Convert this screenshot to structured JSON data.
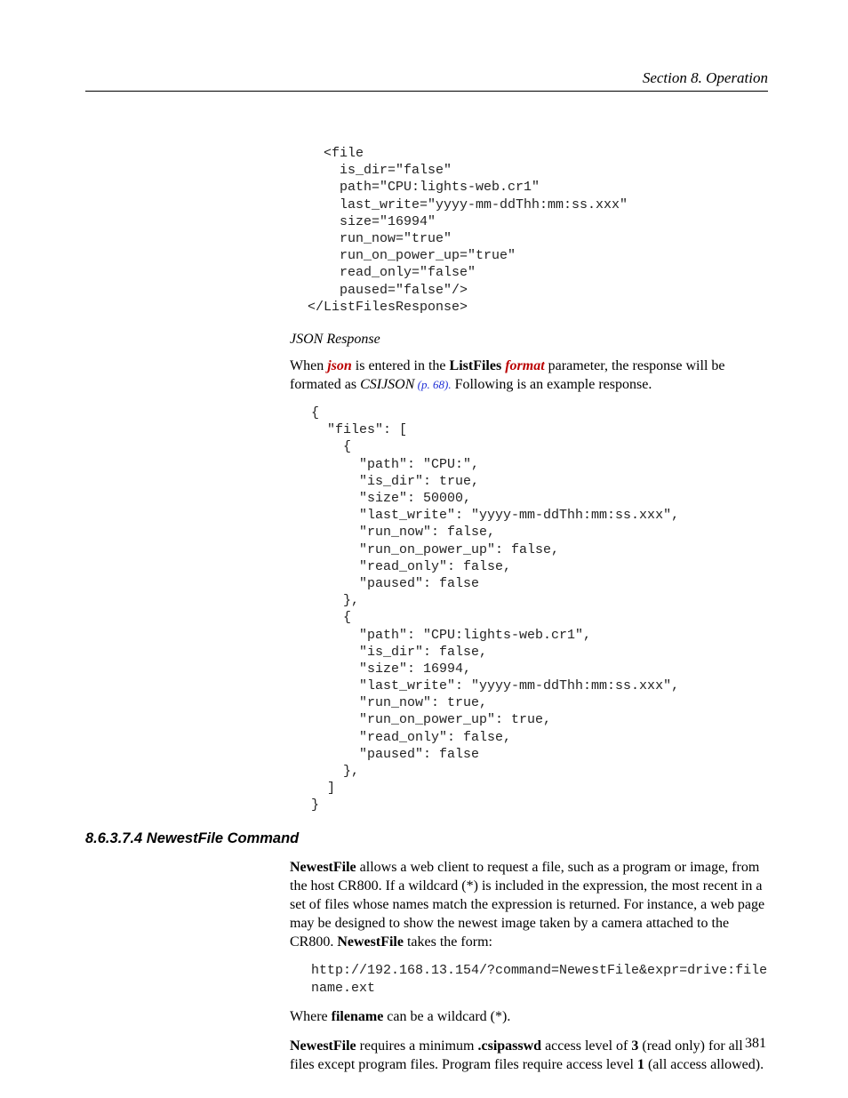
{
  "header": {
    "running_head": "Section 8.  Operation"
  },
  "code1": "  <file\n    is_dir=\"false\"\n    path=\"CPU:lights-web.cr1\"\n    last_write=\"yyyy-mm-ddThh:mm:ss.xxx\"\n    size=\"16994\"\n    run_now=\"true\"\n    run_on_power_up=\"true\"\n    read_only=\"false\"\n    paused=\"false\"/>\n</ListFilesResponse>",
  "json_response_heading": "JSON Response",
  "para1": {
    "t1": "When ",
    "t2": "json",
    "t3": " is entered in the ",
    "t4": "ListFiles",
    "t5": " ",
    "t6": "format",
    "t7": " parameter, the response will be formated as ",
    "t8": "CSIJSON",
    "t9": " (p. 68).",
    "t10": "  Following is an example response."
  },
  "code2": "{\n  \"files\": [\n    {\n      \"path\": \"CPU:\",\n      \"is_dir\": true,\n      \"size\": 50000,\n      \"last_write\": \"yyyy-mm-ddThh:mm:ss.xxx\",\n      \"run_now\": false,\n      \"run_on_power_up\": false,\n      \"read_only\": false,\n      \"paused\": false\n    },\n    {\n      \"path\": \"CPU:lights-web.cr1\",\n      \"is_dir\": false,\n      \"size\": 16994,\n      \"last_write\": \"yyyy-mm-ddThh:mm:ss.xxx\",\n      \"run_now\": true,\n      \"run_on_power_up\": true,\n      \"read_only\": false,\n      \"paused\": false\n    },\n  ]\n}",
  "section_heading": "8.6.3.7.4 NewestFile Command",
  "para2": {
    "t1": "NewestFile",
    "t2": " allows a web client to request a file, such as a program or image, from the host CR800.  If a wildcard (*) is included in the expression, the most recent in a set of files whose names match the expression is returned.  For instance, a web page may be designed to show the newest image taken by a camera attached to the CR800.  ",
    "t3": "NewestFile",
    "t4": " takes the form:"
  },
  "code3": "http://192.168.13.154/?command=NewestFile&expr=drive:filename.ext",
  "para3": {
    "t1": "Where ",
    "t2": "filename",
    "t3": " can be a wildcard (*)."
  },
  "para4": {
    "t1": "NewestFile",
    "t2": " requires a minimum ",
    "t3": ".csipasswd",
    "t4": " access level of ",
    "t5": "3",
    "t6": " (read only) for all files except program files.  Program files require access level ",
    "t7": "1",
    "t8": " (all access allowed)."
  },
  "page_number": "381"
}
